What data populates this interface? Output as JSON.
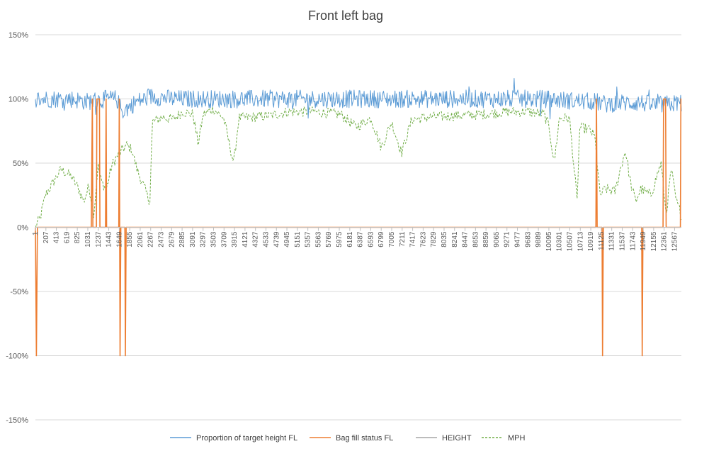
{
  "chart_data": {
    "type": "line",
    "title": "Front left bag",
    "xlabel": "",
    "ylabel": "",
    "x_range": [
      1,
      12700
    ],
    "x_tick_labels": [
      "1",
      "207",
      "413",
      "619",
      "825",
      "1031",
      "1237",
      "1443",
      "1649",
      "1855",
      "2061",
      "2267",
      "2473",
      "2679",
      "2885",
      "3091",
      "3297",
      "3503",
      "3709",
      "3915",
      "4121",
      "4327",
      "4533",
      "4739",
      "4945",
      "5151",
      "5357",
      "5563",
      "5769",
      "5975",
      "6181",
      "6387",
      "6593",
      "6799",
      "7005",
      "7211",
      "7417",
      "7623",
      "7829",
      "8035",
      "8241",
      "8447",
      "8653",
      "8859",
      "9065",
      "9271",
      "9477",
      "9683",
      "9889",
      "10095",
      "10301",
      "10507",
      "10713",
      "10919",
      "11125",
      "11331",
      "11537",
      "11743",
      "11949",
      "12155",
      "12361",
      "12567"
    ],
    "y_ticks": [
      -1.5,
      -1.0,
      -0.5,
      0,
      0.5,
      1.0,
      1.5
    ],
    "y_tick_labels": [
      "-150%",
      "-100%",
      "-50%",
      "0%",
      "50%",
      "100%",
      "150%"
    ],
    "ylim": [
      -1.5,
      1.5
    ],
    "grid": "horizontal",
    "legend_position": "bottom",
    "series": [
      {
        "name": "Proportion of target height FL",
        "color": "#5b9bd5",
        "style": "solid",
        "points": [
          [
            1,
            1.0
          ],
          [
            300,
            1.0
          ],
          [
            700,
            1.0
          ],
          [
            1000,
            0.98
          ],
          [
            1200,
            0.99
          ],
          [
            1400,
            1.0
          ],
          [
            1600,
            1.0
          ],
          [
            1700,
            0.9
          ],
          [
            2000,
            0.98
          ],
          [
            2300,
            1.02
          ],
          [
            2700,
            1.0
          ],
          [
            3500,
            1.0
          ],
          [
            5000,
            1.0
          ],
          [
            6000,
            1.0
          ],
          [
            7000,
            1.0
          ],
          [
            8000,
            1.0
          ],
          [
            9000,
            1.0
          ],
          [
            10000,
            1.0
          ],
          [
            10800,
            0.98
          ],
          [
            11000,
            0.98
          ],
          [
            11200,
            0.96
          ],
          [
            11500,
            0.97
          ],
          [
            11900,
            0.97
          ],
          [
            12200,
            0.95
          ],
          [
            12700,
            0.97
          ]
        ]
      },
      {
        "name": "Bag fill status FL",
        "color": "#ed7d31",
        "style": "solid",
        "points": [
          [
            1,
            0
          ],
          [
            20,
            -1.0
          ],
          [
            40,
            0
          ],
          [
            1100,
            0
          ],
          [
            1120,
            1.0
          ],
          [
            1130,
            0
          ],
          [
            1200,
            0
          ],
          [
            1210,
            1.0
          ],
          [
            1260,
            1.0
          ],
          [
            1270,
            0
          ],
          [
            1380,
            0
          ],
          [
            1390,
            1.0
          ],
          [
            1400,
            0
          ],
          [
            1640,
            0
          ],
          [
            1650,
            1.0
          ],
          [
            1665,
            -1.0
          ],
          [
            1680,
            0
          ],
          [
            1760,
            0
          ],
          [
            1770,
            -1.0
          ],
          [
            1785,
            0
          ],
          [
            11020,
            0
          ],
          [
            11030,
            1.0
          ],
          [
            11045,
            0
          ],
          [
            11140,
            0
          ],
          [
            11150,
            -1.0
          ],
          [
            11165,
            0
          ],
          [
            11920,
            0
          ],
          [
            11930,
            -1.0
          ],
          [
            11945,
            0
          ],
          [
            12340,
            0
          ],
          [
            12350,
            1.0
          ],
          [
            12390,
            1.0
          ],
          [
            12400,
            0
          ],
          [
            12680,
            0
          ],
          [
            12690,
            1.0
          ],
          [
            12700,
            1.0
          ]
        ]
      },
      {
        "name": "HEIGHT",
        "color": "#a5a5a5",
        "style": "solid",
        "points": [
          [
            1,
            0
          ],
          [
            12700,
            0
          ]
        ]
      },
      {
        "name": "MPH",
        "color": "#70ad47",
        "style": "dashed",
        "points": [
          [
            1,
            0.0
          ],
          [
            100,
            0.08
          ],
          [
            200,
            0.25
          ],
          [
            350,
            0.35
          ],
          [
            500,
            0.45
          ],
          [
            700,
            0.4
          ],
          [
            850,
            0.3
          ],
          [
            950,
            0.2
          ],
          [
            1050,
            0.32
          ],
          [
            1100,
            0.22
          ],
          [
            1150,
            0.1
          ],
          [
            1230,
            0.48
          ],
          [
            1300,
            0.35
          ],
          [
            1400,
            0.3
          ],
          [
            1500,
            0.48
          ],
          [
            1600,
            0.55
          ],
          [
            1700,
            0.6
          ],
          [
            1800,
            0.64
          ],
          [
            1900,
            0.6
          ],
          [
            2000,
            0.45
          ],
          [
            2100,
            0.35
          ],
          [
            2250,
            0.2
          ],
          [
            2300,
            0.82
          ],
          [
            2500,
            0.86
          ],
          [
            2700,
            0.84
          ],
          [
            2900,
            0.9
          ],
          [
            3100,
            0.88
          ],
          [
            3200,
            0.65
          ],
          [
            3300,
            0.88
          ],
          [
            3500,
            0.92
          ],
          [
            3700,
            0.85
          ],
          [
            3900,
            0.5
          ],
          [
            4000,
            0.85
          ],
          [
            4300,
            0.86
          ],
          [
            4600,
            0.87
          ],
          [
            5000,
            0.9
          ],
          [
            5500,
            0.9
          ],
          [
            6000,
            0.88
          ],
          [
            6300,
            0.78
          ],
          [
            6600,
            0.85
          ],
          [
            6800,
            0.62
          ],
          [
            7000,
            0.82
          ],
          [
            7200,
            0.58
          ],
          [
            7400,
            0.84
          ],
          [
            7800,
            0.86
          ],
          [
            8300,
            0.87
          ],
          [
            8800,
            0.88
          ],
          [
            9300,
            0.9
          ],
          [
            9700,
            0.9
          ],
          [
            10000,
            0.88
          ],
          [
            10100,
            0.78
          ],
          [
            10200,
            0.5
          ],
          [
            10300,
            0.85
          ],
          [
            10500,
            0.85
          ],
          [
            10650,
            0.2
          ],
          [
            10700,
            0.78
          ],
          [
            10900,
            0.76
          ],
          [
            11000,
            0.7
          ],
          [
            11100,
            0.25
          ],
          [
            11200,
            0.3
          ],
          [
            11400,
            0.28
          ],
          [
            11500,
            0.45
          ],
          [
            11600,
            0.6
          ],
          [
            11700,
            0.35
          ],
          [
            11800,
            0.2
          ],
          [
            11900,
            0.3
          ],
          [
            12100,
            0.25
          ],
          [
            12300,
            0.5
          ],
          [
            12400,
            0.1
          ],
          [
            12500,
            0.45
          ],
          [
            12600,
            0.2
          ],
          [
            12700,
            0.1
          ]
        ]
      }
    ]
  }
}
